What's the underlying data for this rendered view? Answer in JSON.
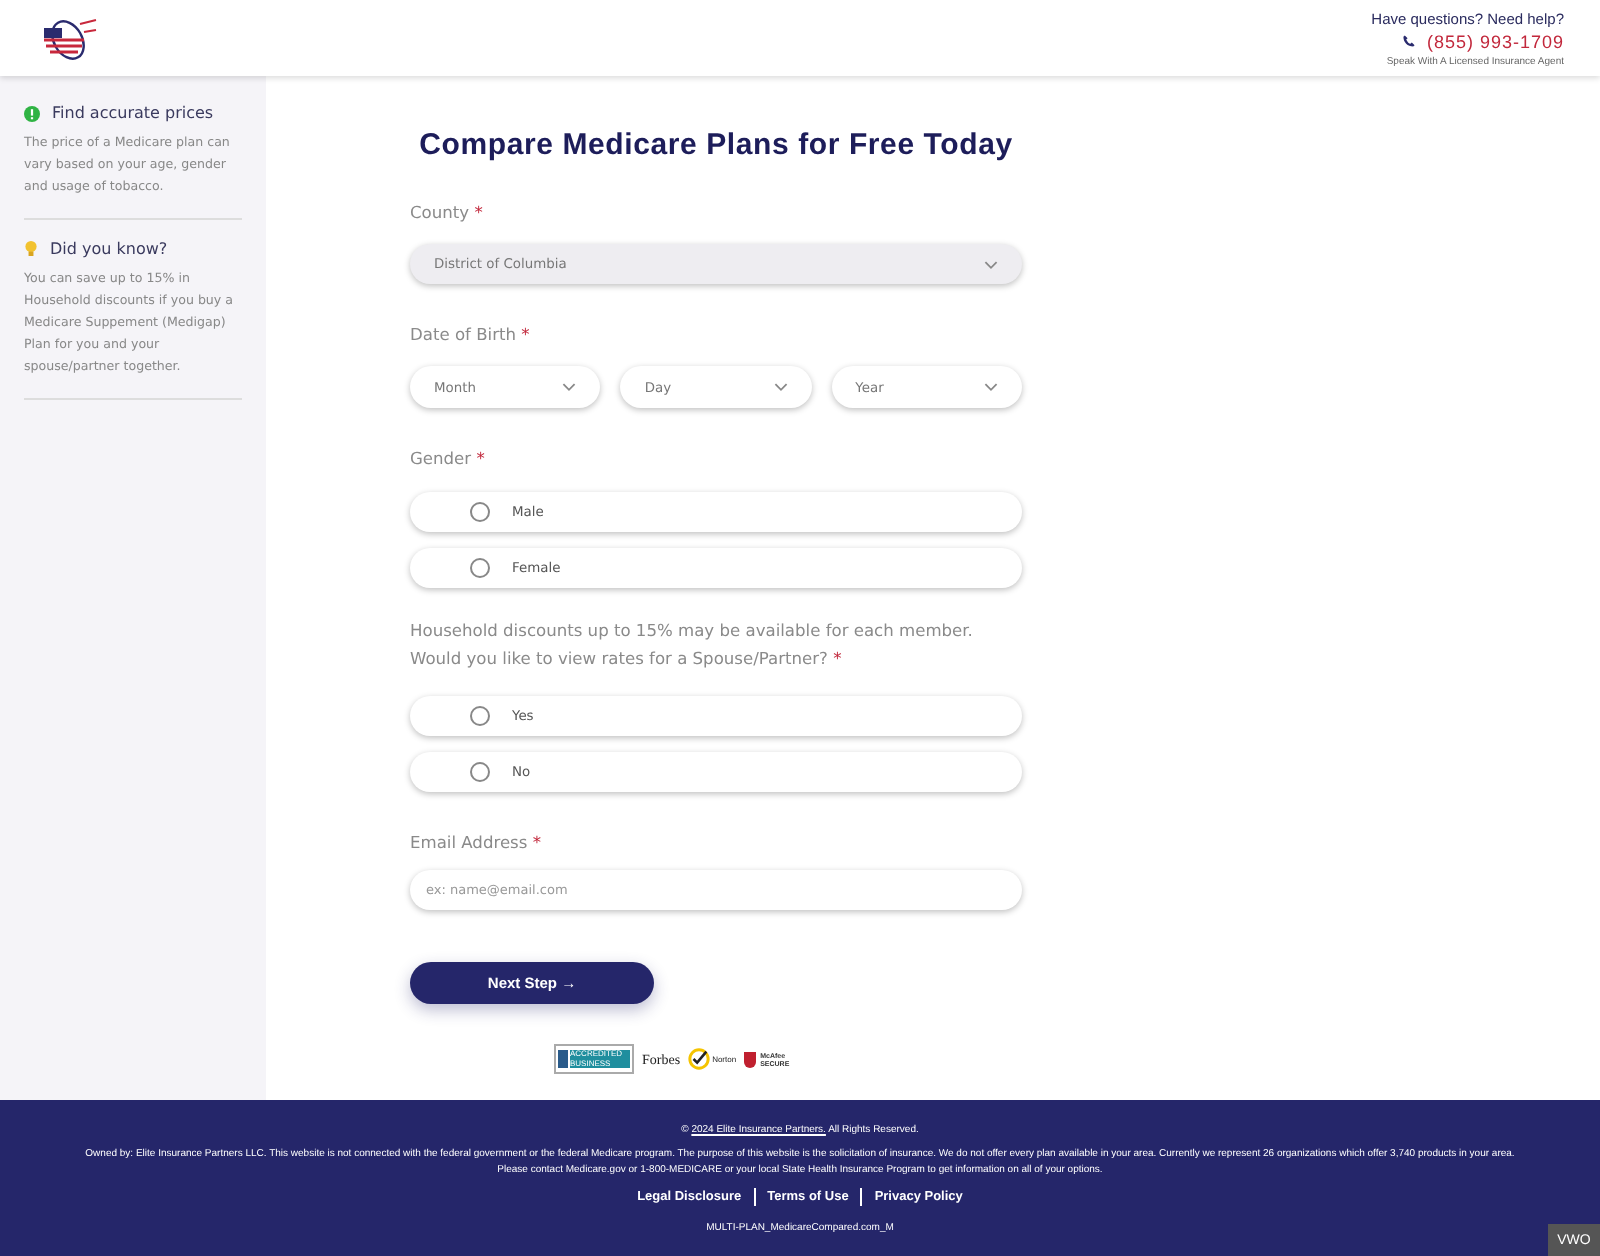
{
  "header": {
    "help_text": "Have questions? Need help?",
    "phone": "(855) 993-1709",
    "agent_text": "Speak With A Licensed Insurance Agent"
  },
  "sidebar": {
    "items": [
      {
        "kind": "info",
        "title": "Find accurate prices",
        "text": "The price of a Medicare plan can vary based on your age, gender and usage of tobacco."
      },
      {
        "kind": "tip",
        "title": "Did you know?",
        "text": "You can save up to 15% in Household discounts if you buy a Medicare Suppement (Medigap) Plan for you and your spouse/partner together."
      }
    ]
  },
  "form": {
    "title": "Compare Medicare Plans for Free Today",
    "county": {
      "label": "County",
      "required": "*",
      "value": "District of Columbia"
    },
    "dob": {
      "label": "Date of Birth",
      "required": "*",
      "selects": [
        "Month",
        "Day",
        "Year"
      ]
    },
    "gender": {
      "label": "Gender",
      "required": "*",
      "options": [
        {
          "label": "Male",
          "selected": false
        },
        {
          "label": "Female",
          "selected": false
        }
      ]
    },
    "spouse": {
      "label": "Household discounts up to 15% may be available for each member. Would you like to view rates for a Spouse/Partner?",
      "required": "*",
      "options": [
        {
          "label": "Yes",
          "selected": false
        },
        {
          "label": "No",
          "selected": false
        }
      ]
    },
    "email": {
      "label": "Email Address",
      "required": "*",
      "placeholder": "ex: name@email.com"
    },
    "submit": {
      "label": "Next Step",
      "arrow": "→"
    },
    "badges": [
      {
        "kind": "bbb",
        "text": "ACCREDITED BUSINESS"
      },
      {
        "kind": "forbes",
        "text": "Forbes"
      },
      {
        "kind": "norton",
        "text": "Norton"
      },
      {
        "kind": "mcafee",
        "text": "McAfee SECURE"
      }
    ]
  },
  "footer": {
    "copyright_prefix": "©",
    "copyright_link": "2024 Elite Insurance Partners.",
    "copyright_suffix": "All Rights Reserved.",
    "disclaimer": "Owned by: Elite Insurance Partners LLC. This website is not connected with the federal government or the federal Medicare program. The purpose of this website is the solicitation of insurance. We do not offer every plan available in your area. Currently we represent 26 organizations which offer 3,740 products in your area. Please contact Medicare.gov or 1-800-MEDICARE or your local State Health Insurance Program to get information on all of your options.",
    "links": [
      "Legal Disclosure",
      "Terms of Use",
      "Privacy Policy"
    ],
    "code": "MULTI-PLAN_MedicareCompared.com_M"
  },
  "corner_badge": "VWO"
}
